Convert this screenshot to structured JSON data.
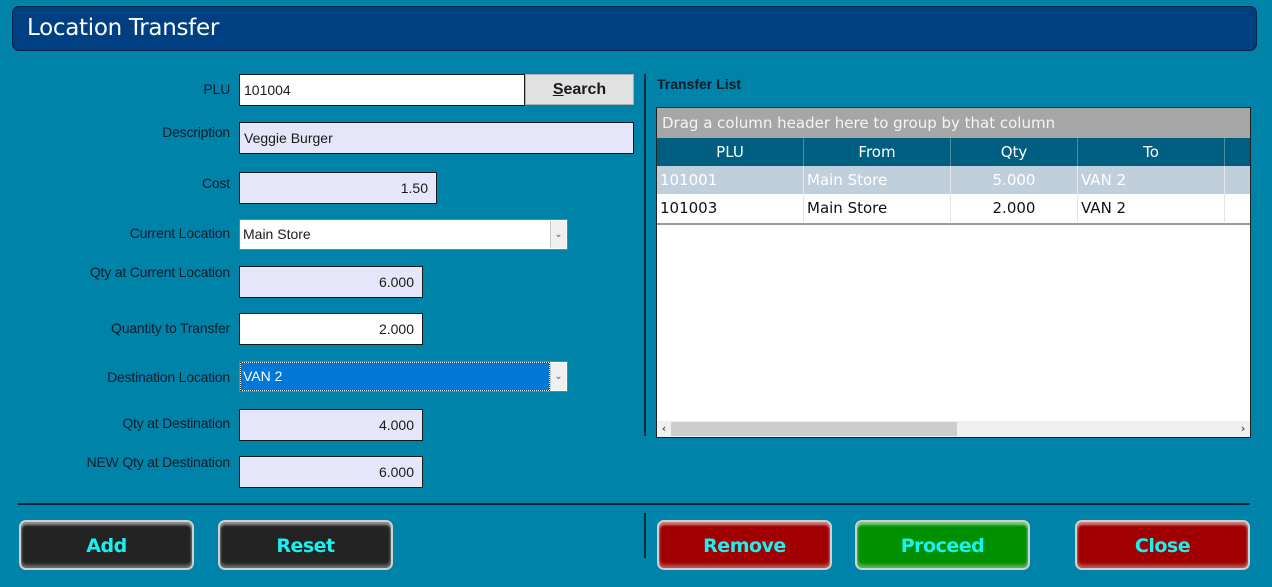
{
  "window": {
    "title": "Location Transfer"
  },
  "form": {
    "plu": {
      "label": "PLU",
      "value": "101004"
    },
    "search_button": {
      "label_first": "S",
      "label_rest": "earch"
    },
    "description": {
      "label": "Description",
      "value": "Veggie Burger"
    },
    "cost": {
      "label": "Cost",
      "value": "1.50"
    },
    "current_location": {
      "label": "Current Location",
      "value": "Main Store"
    },
    "qty_current": {
      "label": "Qty at Current Location",
      "value": "6.000"
    },
    "qty_transfer": {
      "label": "Quantity to Transfer",
      "value": "2.000"
    },
    "destination_location": {
      "label": "Destination Location",
      "value": "VAN 2"
    },
    "qty_destination": {
      "label": "Qty at Destination",
      "value": "4.000"
    },
    "new_qty_destination": {
      "label": "NEW Qty at Destination",
      "value": "6.000"
    }
  },
  "transfer_list": {
    "title": "Transfer List",
    "group_hint": "Drag a column header here to group by that column",
    "columns": [
      "PLU",
      "From",
      "Qty",
      "To"
    ],
    "rows": [
      {
        "plu": "101001",
        "from": "Main Store",
        "qty": "5.000",
        "to": "VAN 2",
        "selected": true
      },
      {
        "plu": "101003",
        "from": "Main Store",
        "qty": "2.000",
        "to": "VAN 2",
        "selected": false
      }
    ],
    "scroll_left_icon": "‹",
    "scroll_right_icon": "›"
  },
  "buttons": {
    "add": "Add",
    "reset": "Reset",
    "remove": "Remove",
    "proceed": "Proceed",
    "close": "Close"
  },
  "colors": {
    "background": "#0083a8",
    "titlebar": "#003f82",
    "button_text": "#19f0f0",
    "red_button": "#a00000",
    "green_button": "#009000",
    "dark_button": "#232323"
  }
}
